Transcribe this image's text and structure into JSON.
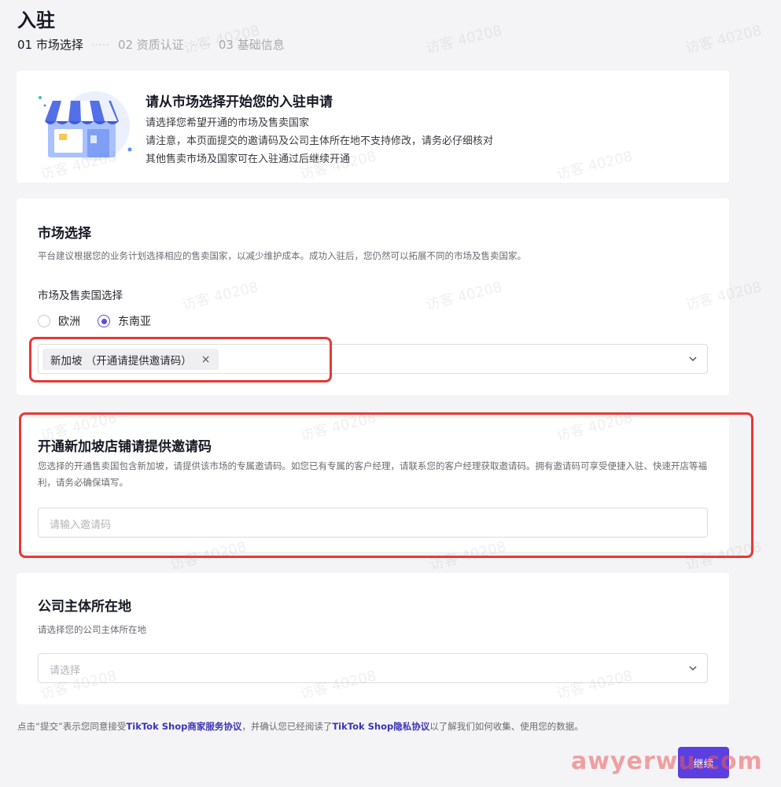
{
  "page": {
    "title": "入驻"
  },
  "steps": [
    {
      "label": "01 市场选择",
      "active": true
    },
    {
      "label": "02 资质认证",
      "active": false
    },
    {
      "label": "03 基础信息",
      "active": false
    }
  ],
  "steps_separator": "·····",
  "intro": {
    "title": "请从市场选择开始您的入驻申请",
    "line1": "请选择您希望开通的市场及售卖国家",
    "line2": "请注意，本页面提交的邀请码及公司主体所在地不支持修改，请务必仔细核对",
    "line3": "其他售卖市场及国家可在入驻通过后继续开通"
  },
  "market": {
    "title": "市场选择",
    "description": "平台建议根据您的业务计划选择相应的售卖国家，以减少维护成本。成功入驻后，您仍然可以拓展不同的市场及售卖国家。",
    "field_label": "市场及售卖国选择",
    "radio_options": [
      {
        "label": "欧洲",
        "checked": false
      },
      {
        "label": "东南亚",
        "checked": true
      }
    ],
    "selected_tag": "新加坡 （开通请提供邀请码）",
    "tag_close": "×"
  },
  "invite": {
    "title": "开通新加坡店铺请提供邀请码",
    "description": "您选择的开通售卖国包含新加坡，请提供该市场的专属邀请码。如您已有专属的客户经理，请联系您的客户经理获取邀请码。拥有邀请码可享受便捷入驻、快速开店等福利，请务必确保填写。",
    "placeholder": "请输入邀请码"
  },
  "company": {
    "title": "公司主体所在地",
    "description": "请选择您的公司主体所在地",
    "placeholder": "请选择"
  },
  "agreement": {
    "prefix": "点击“提交”表示您同意接受",
    "link1": "TikTok Shop商家服务协议",
    "middle": "，并确认您已经阅读了",
    "link2": "TikTok Shop隐私协议",
    "suffix": "以了解我们如何收集、使用您的数据。"
  },
  "actions": {
    "continue_label": "继续"
  },
  "watermarks": {
    "visitor": "访客 40208",
    "site": "awyerwu.com"
  },
  "colors": {
    "accent": "#5b3fe0",
    "highlight": "#e53935",
    "link": "#3d34b8"
  }
}
